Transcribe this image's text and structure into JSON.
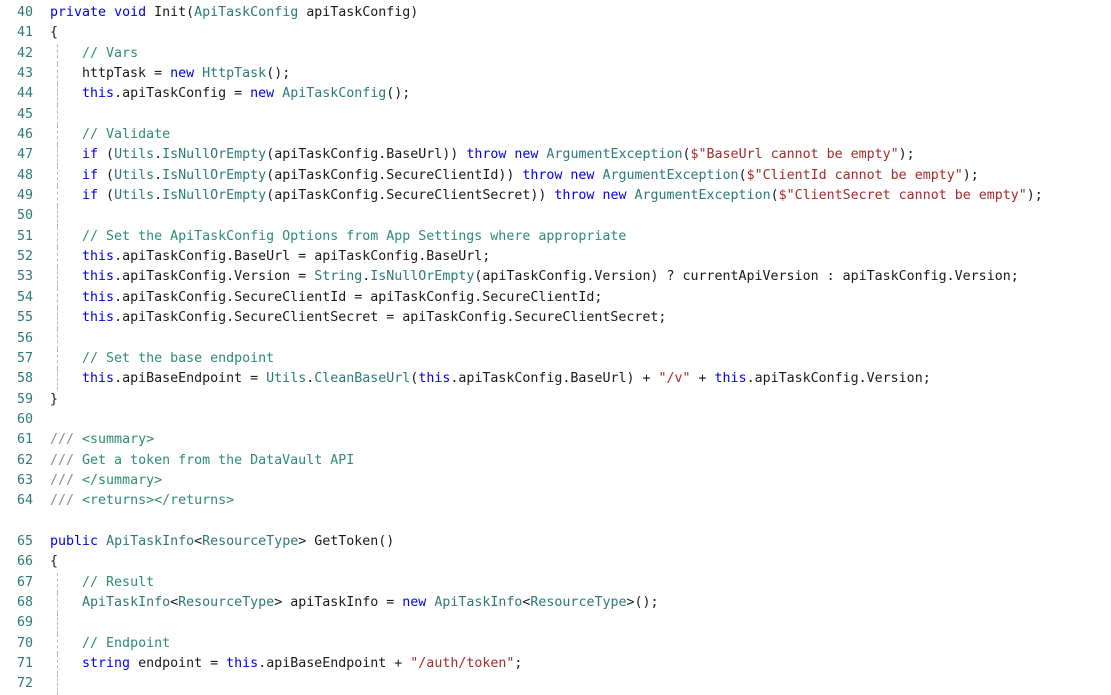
{
  "editor": {
    "language": "csharp",
    "first_line_number": 40,
    "colors": {
      "background": "#ffffff",
      "gutter_text": "#2B7A78",
      "keyword": "#0000E6",
      "type": "#2B7A78",
      "string": "#A52A2A",
      "comment": "#2E8B74",
      "doc_slash": "#8a8a8a",
      "plain": "#1a1a1a",
      "indent_guide": "#b9b9b9"
    }
  },
  "lines": [
    {
      "number": "40",
      "guide": false,
      "tokens": [
        {
          "t": "private",
          "c": "kw"
        },
        {
          "t": " ",
          "c": "pln"
        },
        {
          "t": "void",
          "c": "kw"
        },
        {
          "t": " ",
          "c": "pln"
        },
        {
          "t": "Init(",
          "c": "pln"
        },
        {
          "t": "ApiTaskConfig",
          "c": "typ"
        },
        {
          "t": " apiTaskConfig)",
          "c": "pln"
        }
      ]
    },
    {
      "number": "41",
      "guide": false,
      "tokens": [
        {
          "t": "{",
          "c": "pln"
        }
      ]
    },
    {
      "number": "42",
      "guide": true,
      "tokens": [
        {
          "t": "    ",
          "c": "pln"
        },
        {
          "t": "// Vars",
          "c": "cmt"
        }
      ]
    },
    {
      "number": "43",
      "guide": true,
      "tokens": [
        {
          "t": "    httpTask = ",
          "c": "pln"
        },
        {
          "t": "new",
          "c": "kw"
        },
        {
          "t": " ",
          "c": "pln"
        },
        {
          "t": "HttpTask",
          "c": "typ"
        },
        {
          "t": "();",
          "c": "pln"
        }
      ]
    },
    {
      "number": "44",
      "guide": true,
      "tokens": [
        {
          "t": "    ",
          "c": "pln"
        },
        {
          "t": "this",
          "c": "kw"
        },
        {
          "t": ".apiTaskConfig = ",
          "c": "pln"
        },
        {
          "t": "new",
          "c": "kw"
        },
        {
          "t": " ",
          "c": "pln"
        },
        {
          "t": "ApiTaskConfig",
          "c": "typ"
        },
        {
          "t": "();",
          "c": "pln"
        }
      ]
    },
    {
      "number": "45",
      "guide": true,
      "tokens": []
    },
    {
      "number": "46",
      "guide": true,
      "tokens": [
        {
          "t": "    ",
          "c": "pln"
        },
        {
          "t": "// Validate",
          "c": "cmt"
        }
      ]
    },
    {
      "number": "47",
      "guide": true,
      "tokens": [
        {
          "t": "    ",
          "c": "pln"
        },
        {
          "t": "if",
          "c": "kw"
        },
        {
          "t": " (",
          "c": "pln"
        },
        {
          "t": "Utils",
          "c": "typ"
        },
        {
          "t": ".",
          "c": "pln"
        },
        {
          "t": "IsNullOrEmpty",
          "c": "typ"
        },
        {
          "t": "(apiTaskConfig.BaseUrl)) ",
          "c": "pln"
        },
        {
          "t": "throw",
          "c": "kw"
        },
        {
          "t": " ",
          "c": "pln"
        },
        {
          "t": "new",
          "c": "kw"
        },
        {
          "t": " ",
          "c": "pln"
        },
        {
          "t": "ArgumentException",
          "c": "typ"
        },
        {
          "t": "(",
          "c": "pln"
        },
        {
          "t": "$\"BaseUrl cannot be empty\"",
          "c": "str"
        },
        {
          "t": ");",
          "c": "pln"
        }
      ]
    },
    {
      "number": "48",
      "guide": true,
      "tokens": [
        {
          "t": "    ",
          "c": "pln"
        },
        {
          "t": "if",
          "c": "kw"
        },
        {
          "t": " (",
          "c": "pln"
        },
        {
          "t": "Utils",
          "c": "typ"
        },
        {
          "t": ".",
          "c": "pln"
        },
        {
          "t": "IsNullOrEmpty",
          "c": "typ"
        },
        {
          "t": "(apiTaskConfig.SecureClientId)) ",
          "c": "pln"
        },
        {
          "t": "throw",
          "c": "kw"
        },
        {
          "t": " ",
          "c": "pln"
        },
        {
          "t": "new",
          "c": "kw"
        },
        {
          "t": " ",
          "c": "pln"
        },
        {
          "t": "ArgumentException",
          "c": "typ"
        },
        {
          "t": "(",
          "c": "pln"
        },
        {
          "t": "$\"ClientId cannot be empty\"",
          "c": "str"
        },
        {
          "t": ");",
          "c": "pln"
        }
      ]
    },
    {
      "number": "49",
      "guide": true,
      "tokens": [
        {
          "t": "    ",
          "c": "pln"
        },
        {
          "t": "if",
          "c": "kw"
        },
        {
          "t": " (",
          "c": "pln"
        },
        {
          "t": "Utils",
          "c": "typ"
        },
        {
          "t": ".",
          "c": "pln"
        },
        {
          "t": "IsNullOrEmpty",
          "c": "typ"
        },
        {
          "t": "(apiTaskConfig.SecureClientSecret)) ",
          "c": "pln"
        },
        {
          "t": "throw",
          "c": "kw"
        },
        {
          "t": " ",
          "c": "pln"
        },
        {
          "t": "new",
          "c": "kw"
        },
        {
          "t": " ",
          "c": "pln"
        },
        {
          "t": "ArgumentException",
          "c": "typ"
        },
        {
          "t": "(",
          "c": "pln"
        },
        {
          "t": "$\"ClientSecret cannot be empty\"",
          "c": "str"
        },
        {
          "t": ");",
          "c": "pln"
        }
      ]
    },
    {
      "number": "50",
      "guide": true,
      "tokens": []
    },
    {
      "number": "51",
      "guide": true,
      "tokens": [
        {
          "t": "    ",
          "c": "pln"
        },
        {
          "t": "// Set the ApiTaskConfig Options from App Settings where appropriate",
          "c": "cmt"
        }
      ]
    },
    {
      "number": "52",
      "guide": true,
      "tokens": [
        {
          "t": "    ",
          "c": "pln"
        },
        {
          "t": "this",
          "c": "kw"
        },
        {
          "t": ".apiTaskConfig.BaseUrl = apiTaskConfig.BaseUrl;",
          "c": "pln"
        }
      ]
    },
    {
      "number": "53",
      "guide": true,
      "tokens": [
        {
          "t": "    ",
          "c": "pln"
        },
        {
          "t": "this",
          "c": "kw"
        },
        {
          "t": ".apiTaskConfig.Version = ",
          "c": "pln"
        },
        {
          "t": "String",
          "c": "typ"
        },
        {
          "t": ".",
          "c": "pln"
        },
        {
          "t": "IsNullOrEmpty",
          "c": "typ"
        },
        {
          "t": "(apiTaskConfig.Version) ? currentApiVersion : apiTaskConfig.Version;",
          "c": "pln"
        }
      ]
    },
    {
      "number": "54",
      "guide": true,
      "tokens": [
        {
          "t": "    ",
          "c": "pln"
        },
        {
          "t": "this",
          "c": "kw"
        },
        {
          "t": ".apiTaskConfig.SecureClientId = apiTaskConfig.SecureClientId;",
          "c": "pln"
        }
      ]
    },
    {
      "number": "55",
      "guide": true,
      "tokens": [
        {
          "t": "    ",
          "c": "pln"
        },
        {
          "t": "this",
          "c": "kw"
        },
        {
          "t": ".apiTaskConfig.SecureClientSecret = apiTaskConfig.SecureClientSecret;",
          "c": "pln"
        }
      ]
    },
    {
      "number": "56",
      "guide": true,
      "tokens": []
    },
    {
      "number": "57",
      "guide": true,
      "tokens": [
        {
          "t": "    ",
          "c": "pln"
        },
        {
          "t": "// Set the base endpoint",
          "c": "cmt"
        }
      ]
    },
    {
      "number": "58",
      "guide": true,
      "tokens": [
        {
          "t": "    ",
          "c": "pln"
        },
        {
          "t": "this",
          "c": "kw"
        },
        {
          "t": ".apiBaseEndpoint = ",
          "c": "pln"
        },
        {
          "t": "Utils",
          "c": "typ"
        },
        {
          "t": ".",
          "c": "pln"
        },
        {
          "t": "CleanBaseUrl",
          "c": "typ"
        },
        {
          "t": "(",
          "c": "pln"
        },
        {
          "t": "this",
          "c": "kw"
        },
        {
          "t": ".apiTaskConfig.BaseUrl) + ",
          "c": "pln"
        },
        {
          "t": "\"/v\"",
          "c": "str"
        },
        {
          "t": " + ",
          "c": "pln"
        },
        {
          "t": "this",
          "c": "kw"
        },
        {
          "t": ".apiTaskConfig.Version;",
          "c": "pln"
        }
      ]
    },
    {
      "number": "59",
      "guide": false,
      "tokens": [
        {
          "t": "}",
          "c": "pln"
        }
      ]
    },
    {
      "number": "60",
      "guide": false,
      "tokens": []
    },
    {
      "number": "61",
      "guide": false,
      "tokens": [
        {
          "t": "///",
          "c": "doc"
        },
        {
          "t": " <summary>",
          "c": "cmt"
        }
      ]
    },
    {
      "number": "62",
      "guide": false,
      "tokens": [
        {
          "t": "///",
          "c": "doc"
        },
        {
          "t": " Get a token from the DataVault API",
          "c": "cmt"
        }
      ]
    },
    {
      "number": "63",
      "guide": false,
      "tokens": [
        {
          "t": "///",
          "c": "doc"
        },
        {
          "t": " </summary>",
          "c": "cmt"
        }
      ]
    },
    {
      "number": "64",
      "guide": false,
      "tokens": [
        {
          "t": "///",
          "c": "doc"
        },
        {
          "t": " <returns></returns>",
          "c": "cmt"
        }
      ]
    },
    {
      "number": "",
      "guide": false,
      "tokens": []
    },
    {
      "number": "65",
      "guide": false,
      "tokens": [
        {
          "t": "public",
          "c": "kw"
        },
        {
          "t": " ",
          "c": "pln"
        },
        {
          "t": "ApiTaskInfo",
          "c": "typ"
        },
        {
          "t": "<",
          "c": "pln"
        },
        {
          "t": "ResourceType",
          "c": "typ"
        },
        {
          "t": "> GetToken()",
          "c": "pln"
        }
      ]
    },
    {
      "number": "66",
      "guide": false,
      "tokens": [
        {
          "t": "{",
          "c": "pln"
        }
      ]
    },
    {
      "number": "67",
      "guide": true,
      "tokens": [
        {
          "t": "    ",
          "c": "pln"
        },
        {
          "t": "// Result",
          "c": "cmt"
        }
      ]
    },
    {
      "number": "68",
      "guide": true,
      "tokens": [
        {
          "t": "    ",
          "c": "pln"
        },
        {
          "t": "ApiTaskInfo",
          "c": "typ"
        },
        {
          "t": "<",
          "c": "pln"
        },
        {
          "t": "ResourceType",
          "c": "typ"
        },
        {
          "t": "> apiTaskInfo = ",
          "c": "pln"
        },
        {
          "t": "new",
          "c": "kw"
        },
        {
          "t": " ",
          "c": "pln"
        },
        {
          "t": "ApiTaskInfo",
          "c": "typ"
        },
        {
          "t": "<",
          "c": "pln"
        },
        {
          "t": "ResourceType",
          "c": "typ"
        },
        {
          "t": ">();",
          "c": "pln"
        }
      ]
    },
    {
      "number": "69",
      "guide": true,
      "tokens": []
    },
    {
      "number": "70",
      "guide": true,
      "tokens": [
        {
          "t": "    ",
          "c": "pln"
        },
        {
          "t": "// Endpoint",
          "c": "cmt"
        }
      ]
    },
    {
      "number": "71",
      "guide": true,
      "tokens": [
        {
          "t": "    ",
          "c": "pln"
        },
        {
          "t": "string",
          "c": "kw"
        },
        {
          "t": " endpoint = ",
          "c": "pln"
        },
        {
          "t": "this",
          "c": "kw"
        },
        {
          "t": ".apiBaseEndpoint + ",
          "c": "pln"
        },
        {
          "t": "\"/auth/token\"",
          "c": "str"
        },
        {
          "t": ";",
          "c": "pln"
        }
      ]
    },
    {
      "number": "72",
      "guide": true,
      "tokens": []
    }
  ]
}
